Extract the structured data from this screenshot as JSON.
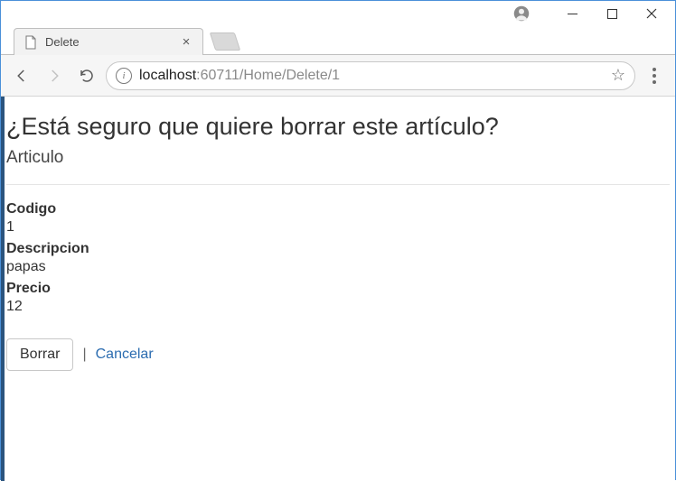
{
  "window": {
    "tab_title": "Delete"
  },
  "nav": {
    "url_host": "localhost",
    "url_rest": ":60711/Home/Delete/1"
  },
  "page": {
    "heading": "¿Está seguro que quiere borrar este artículo?",
    "subtitle": "Articulo",
    "fields": {
      "codigo_label": "Codigo",
      "codigo_value": "1",
      "descripcion_label": "Descripcion",
      "descripcion_value": "papas",
      "precio_label": "Precio",
      "precio_value": "12"
    },
    "actions": {
      "delete_label": "Borrar",
      "separator": "|",
      "cancel_label": "Cancelar"
    }
  }
}
